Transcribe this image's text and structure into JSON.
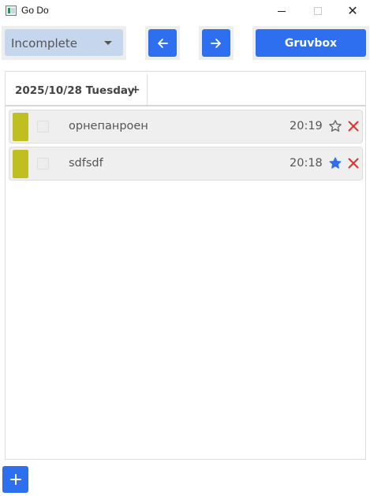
{
  "window": {
    "title": "Go Do",
    "close_glyph": "✕"
  },
  "toolbar": {
    "filter_value": "Incomplete",
    "prev_icon": "arrow-left-icon",
    "next_icon": "arrow-right-icon",
    "theme_label": "Gruvbox"
  },
  "tabs": [
    {
      "label": "2025/10/28 Tuesday",
      "add_label": "+"
    }
  ],
  "tasks": [
    {
      "title": "орнепанроен",
      "time": "20:19",
      "starred": false,
      "color": "#bfbf22"
    },
    {
      "title": "sdfsdf",
      "time": "20:18",
      "starred": true,
      "color": "#bfbf22"
    }
  ],
  "colors": {
    "accent": "#2e6ff0",
    "filter_bg": "#c6d6ec",
    "delete": "#e03030",
    "star_on": "#2e6ff0",
    "star_off": "#666666"
  },
  "footer": {
    "add_icon": "plus-icon"
  }
}
